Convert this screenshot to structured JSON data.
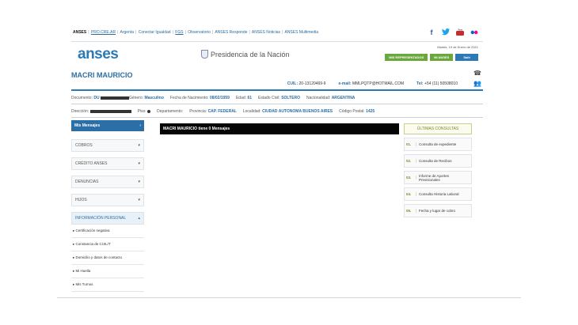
{
  "topnav": [
    "ANSES",
    "PRO.CRE.AR",
    "Argenta",
    "Conectar Igualdad",
    "FGS",
    "Observatorio",
    "ANSES Responde",
    "ANSES Noticias",
    "ANSES Multimedia"
  ],
  "social": [
    {
      "icon": "facebook-icon",
      "glyph": "f",
      "color": "#3b5998"
    },
    {
      "icon": "twitter-icon",
      "glyph": "t",
      "color": "#1da1f2"
    },
    {
      "icon": "youtube-icon",
      "glyph": "▶",
      "color": "#cc2a2a"
    },
    {
      "icon": "flickr-icon",
      "glyph": "●●",
      "color": "#e0347a"
    }
  ],
  "header": {
    "logo": "anses",
    "presidencia": "Presidencia de la Nación",
    "date": "Martes, 19 de Enero de 2021",
    "btn_representados": "MIS REPRESENTADOS",
    "btn_anses": "MI ANSES",
    "btn_salir": "Salir"
  },
  "user": {
    "name": "MACRI MAURICIO",
    "cuil_label": "CUIL:",
    "cuil": "20-13120469-9",
    "email_label": "e-mail:",
    "email": "MMLPQTP@HOTMAIL.COM",
    "tel_label": "Tel:",
    "tel": "+54 (11) 50508010"
  },
  "info1": {
    "documento_label": "Documento:",
    "documento_type": "DU",
    "genero_label": "Género:",
    "genero": "Masculino",
    "fnac_label": "Fecha de Nacimiento:",
    "fnac": "08/02/1959",
    "edad_label": "Edad:",
    "edad": "61",
    "civil_label": "Estado Civil:",
    "civil": "SOLTERO",
    "nac_label": "Nacionalidad:",
    "nac": "ARGENTINA"
  },
  "info2": {
    "dir_label": "Dirección:",
    "piso_label": "Piso:",
    "depto_label": "Departamento:",
    "prov_label": "Provincia:",
    "prov": "CAP. FEDERAL",
    "loc_label": "Localidad:",
    "loc": "CIUDAD AUTONOMA BUENOS AIRES",
    "cp_label": "Código Postal:",
    "cp": "1425"
  },
  "sidebar": {
    "mis_mensajes": "Mis Mensajes",
    "items": [
      "COBROS",
      "CRÉDITO ANSES",
      "DENUNCIAS",
      "HIJOS"
    ],
    "info_personal": "INFORMACIÓN PERSONAL",
    "subitems": [
      "Certificación negativa",
      "Constancia de CUIL/T",
      "Domicilio y datos de contacto",
      "Mi Huella",
      "Mis Turnos"
    ]
  },
  "main": {
    "message": "MACRI MAURICIO tiene 0 Mensajes"
  },
  "ultimas": {
    "title": "ÚLTIMAS CONSULTAS",
    "items": [
      {
        "num": "01.",
        "label": "Consulta de expediente"
      },
      {
        "num": "02.",
        "label": "Consulta de Recibos"
      },
      {
        "num": "03.",
        "label": "Informe de Aportes Previsionales"
      },
      {
        "num": "04.",
        "label": "Consulta Historia Laboral"
      },
      {
        "num": "05.",
        "label": "Fecha y lugar de cobro"
      }
    ]
  }
}
